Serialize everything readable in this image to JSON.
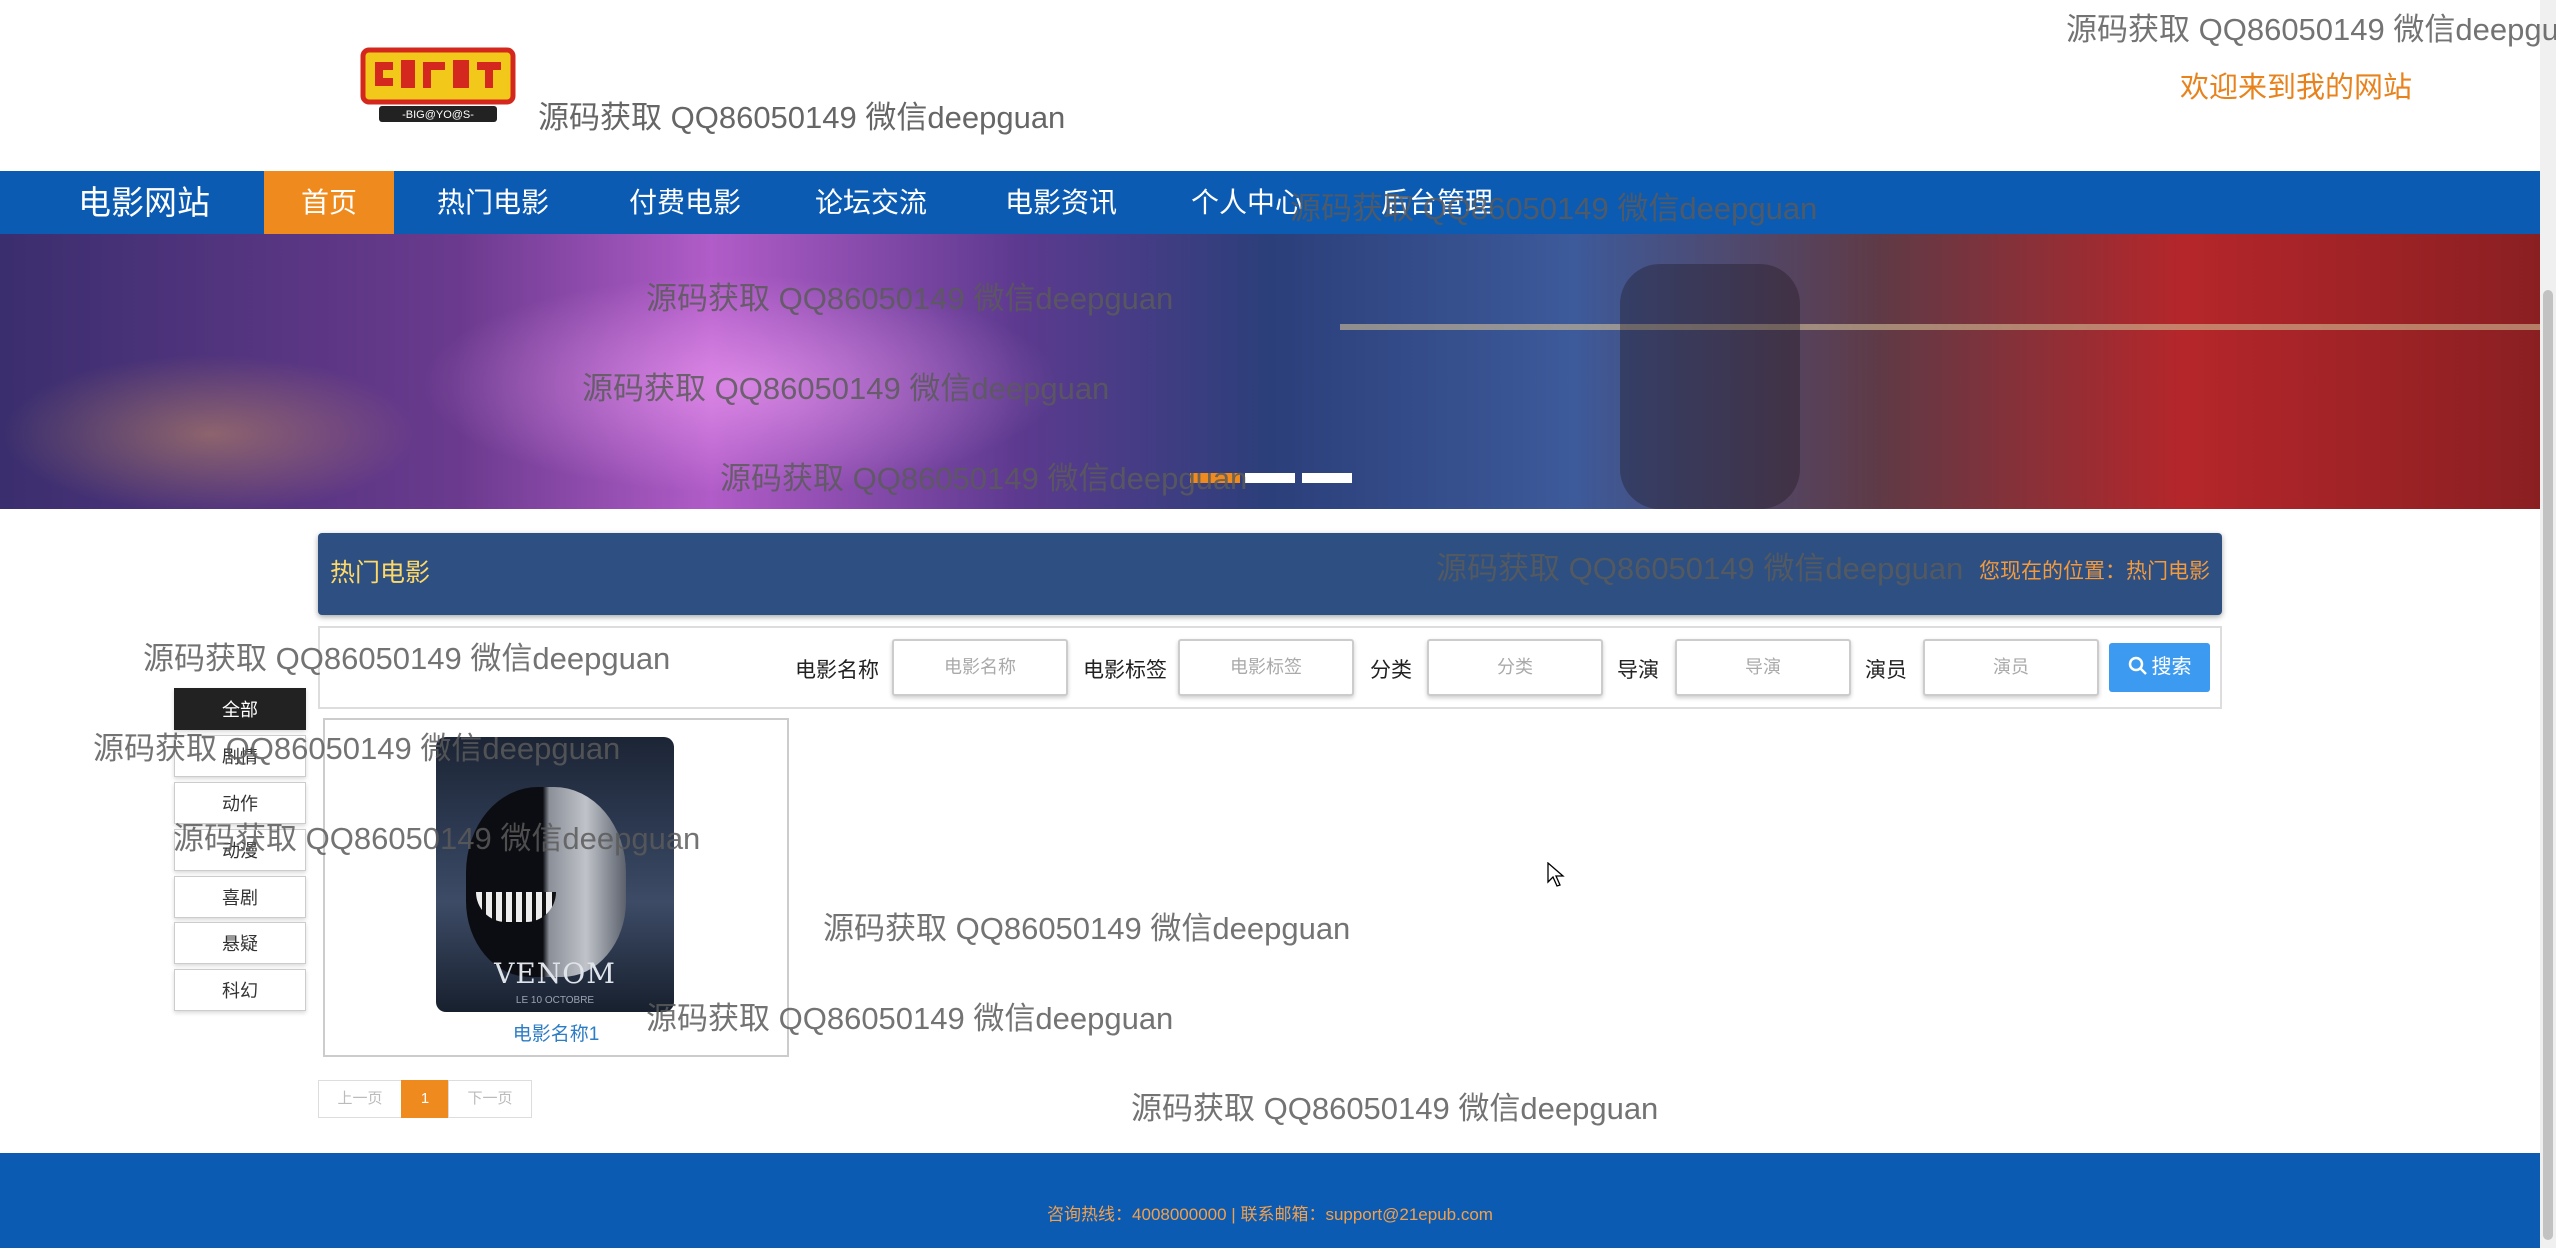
{
  "header": {
    "logo_text": "DIGIMON ADVENTURE -BIG@YO@S-",
    "title": "源码获取 QQ86050149 微信deepguan",
    "welcome": "欢迎来到我的网站"
  },
  "nav": {
    "brand": "电影网站",
    "items": [
      {
        "label": "首页",
        "active": true
      },
      {
        "label": "热门电影"
      },
      {
        "label": "付费电影"
      },
      {
        "label": "论坛交流"
      },
      {
        "label": "电影资讯"
      },
      {
        "label": "个人中心"
      },
      {
        "label": "后台管理"
      }
    ]
  },
  "banner": {
    "slides": 3,
    "active_slide": 1
  },
  "page": {
    "title": "热门电影",
    "location": "您现在的位置：热门电影"
  },
  "search": {
    "fields": [
      {
        "label": "电影名称",
        "placeholder": "电影名称"
      },
      {
        "label": "电影标签",
        "placeholder": "电影标签"
      },
      {
        "label": "分类",
        "placeholder": "分类"
      },
      {
        "label": "导演",
        "placeholder": "导演"
      },
      {
        "label": "演员",
        "placeholder": "演员"
      }
    ],
    "button": "搜索",
    "button_icon": "search-icon"
  },
  "categories": [
    {
      "label": "全部",
      "active": true
    },
    {
      "label": "剧情"
    },
    {
      "label": "动作"
    },
    {
      "label": "动漫"
    },
    {
      "label": "喜剧"
    },
    {
      "label": "悬疑"
    },
    {
      "label": "科幻"
    }
  ],
  "movies": [
    {
      "name": "电影名称1",
      "poster_title": "VENOM",
      "poster_sub": "LE 10 OCTOBRE"
    }
  ],
  "pagination": {
    "prev": "上一页",
    "current": "1",
    "next": "下一页"
  },
  "footer": {
    "text": "咨询热线：4008000000 | 联系邮箱：support@21epub.com"
  },
  "watermarks": [
    "源码获取 QQ86050149 微信deepgu",
    "源码获取 QQ86050149 微信deepguan",
    "源码获取 QQ86050149 微信deepguan",
    "源码获取 QQ86050149 微信deepguan",
    "源码获取 QQ86050149 微信deepguan",
    "源码获取 QQ86050149 微信deepguan",
    "源码获取 QQ86050149 微信deepguan",
    "源码获取 QQ86050149 微信deepguan",
    "源码获取 QQ86050149 微信deepguan",
    "源码获取 QQ86050149 微信deepguan",
    "源码获取 QQ86050149 微信deepguan",
    "源码获取 QQ86050149 微信deepguan"
  ],
  "colors": {
    "nav_bg": "#0c5bb3",
    "accent": "#ef8a1e",
    "titlebar_bg": "#2d4f82",
    "title_text": "#ffd966",
    "search_button": "#3c9bf0",
    "footer_text": "#f3a04a"
  }
}
